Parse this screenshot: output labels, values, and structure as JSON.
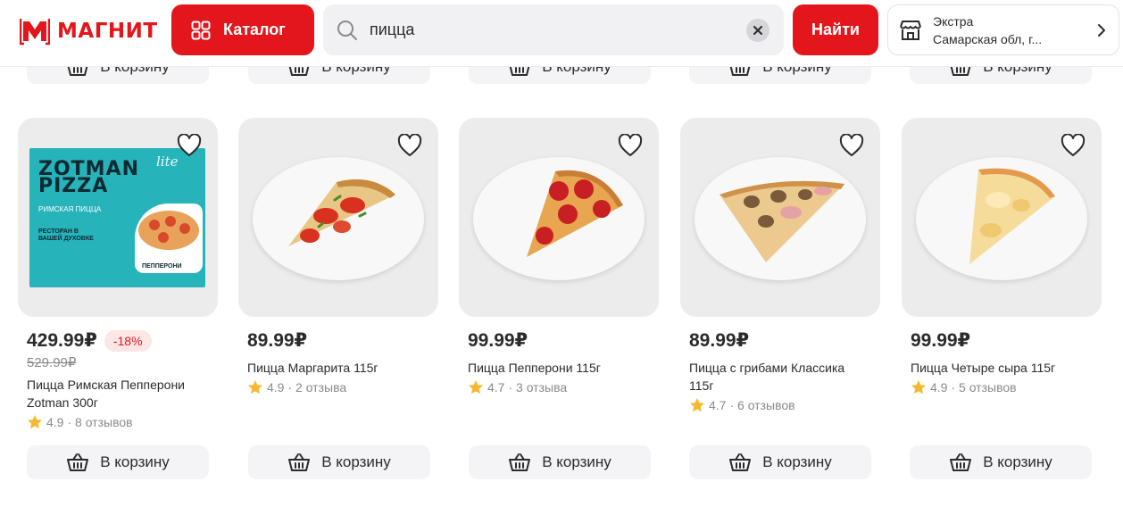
{
  "header": {
    "logo_text": "МАГНИТ",
    "catalog_label": "Каталог",
    "search_value": "пицца",
    "find_label": "Найти",
    "store_name": "Экстра",
    "store_address": "Самарская обл, г..."
  },
  "top_row": {
    "cart_label": "В корзину"
  },
  "products": [
    {
      "price": "429.99₽",
      "discount": "-18%",
      "old_price": "529.99₽",
      "name": "Пицца Римская Пепперони Zotman 300г",
      "rating": "4.9",
      "reviews": "· 8 отзывов",
      "cart_label": "В корзину",
      "box": {
        "brand": "ZOTMAN PIZZA",
        "lite": "lite",
        "subtitle": "РИМСКАЯ ПИЦЦА",
        "tagline": "РЕСТОРАН В ВАШЕЙ ДУХОВКЕ",
        "variant": "ПЕППЕРОНИ"
      }
    },
    {
      "price": "89.99₽",
      "name": "Пицца Маргарита 115г",
      "rating": "4.9",
      "reviews": "· 2 отзыва",
      "cart_label": "В корзину"
    },
    {
      "price": "99.99₽",
      "name": "Пицца Пепперони 115г",
      "rating": "4.7",
      "reviews": "· 3 отзыва",
      "cart_label": "В корзину"
    },
    {
      "price": "89.99₽",
      "name": "Пицца с грибами Классика 115г",
      "rating": "4.7",
      "reviews": "· 6 отзывов",
      "cart_label": "В корзину"
    },
    {
      "price": "99.99₽",
      "name": "Пицца Четыре сыра 115г",
      "rating": "4.9",
      "reviews": "· 5 отзывов",
      "cart_label": "В корзину"
    }
  ],
  "colors": {
    "brand_red": "#e3161b",
    "star": "#f5b92f",
    "zotman_teal": "#27b3ba"
  }
}
